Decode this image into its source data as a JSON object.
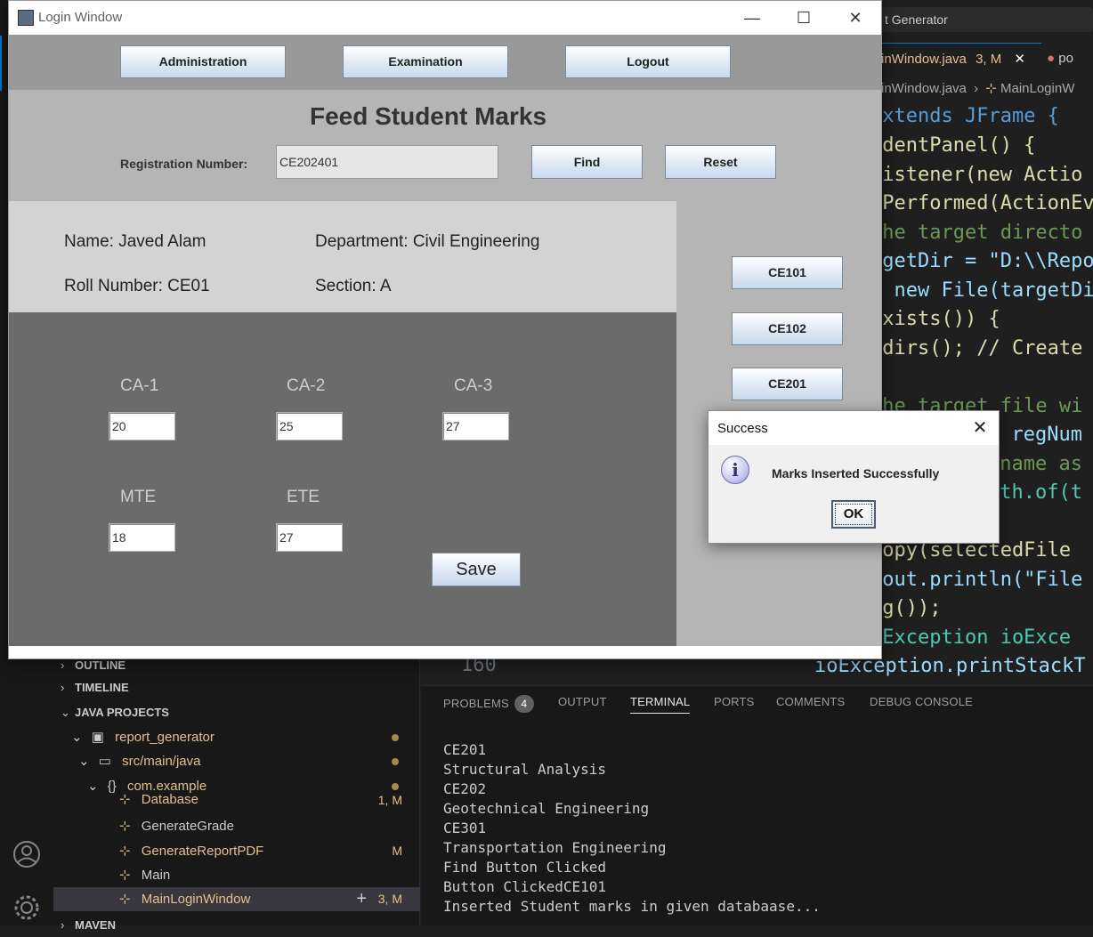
{
  "vscode": {
    "window_title_fragment": "t Generator",
    "active_tab": "inWindow.java",
    "active_tab_badge": "3, M",
    "second_tab": "po",
    "breadcrumb": [
      "inWindow.java",
      "MainLoginW"
    ],
    "code_lines": [
      "xtends JFrame {",
      "udentPanel() {",
      "Listener(new Actio",
      "nPerformed(ActionEv",
      "the target directo",
      "rgetDir = \"D:\\\\Repo",
      "= new File(targetDi",
      "exists()) {",
      "kdirs(); // Create",
      "",
      "the target file wi",
      "= regNum",
      " name as",
      "ath.of(t",
      "",
      "copy(selectedFile",
      ".out.println(\"File",
      "ng());",
      "OException ioExce",
      "ioException.printStackT"
    ],
    "line_number": "160",
    "sidebar_sections": {
      "outline": "OUTLINE",
      "timeline": "TIMELINE",
      "java_projects": "JAVA PROJECTS",
      "maven": "MAVEN"
    },
    "tree": [
      {
        "label": "report_generator",
        "badge": ""
      },
      {
        "label": "src/main/java",
        "badge": ""
      },
      {
        "label": "com.example",
        "badge": ""
      },
      {
        "label": "Database",
        "badge": "1, M"
      },
      {
        "label": "GenerateGrade",
        "badge": ""
      },
      {
        "label": "GenerateReportPDF",
        "badge": "M"
      },
      {
        "label": "Main",
        "badge": ""
      },
      {
        "label": "MainLoginWindow",
        "badge": "3, M"
      }
    ],
    "tree_add": "+",
    "panel_tabs": {
      "problems": "PROBLEMS",
      "problems_count": "4",
      "output": "OUTPUT",
      "terminal": "TERMINAL",
      "ports": "PORTS",
      "comments": "COMMENTS",
      "debug_console": "DEBUG CONSOLE"
    },
    "terminal_lines": [
      "CE201",
      "Structural Analysis",
      "CE202",
      "Geotechnical Engineering",
      "CE301",
      "Transportation Engineering",
      "Find Button Clicked",
      "Button ClickedCE101",
      "Inserted Student marks in given databaase..."
    ]
  },
  "login_window": {
    "title": "Login Window",
    "controls": {
      "minimize": "—",
      "maximize": "☐",
      "close": "✕"
    },
    "nav": {
      "administration": "Administration",
      "examination": "Examination",
      "logout": "Logout"
    },
    "heading": "Feed Student Marks",
    "registration": {
      "label": "Registration Number:",
      "value": "CE202401",
      "find": "Find",
      "reset": "Reset"
    },
    "student": {
      "name": "Name: Javed Alam",
      "department": "Department: Civil Engineering",
      "roll": "Roll Number: CE01",
      "section": "Section: A"
    },
    "marks": {
      "ca1_label": "CA-1",
      "ca1_value": "20",
      "ca2_label": "CA-2",
      "ca2_value": "25",
      "ca3_label": "CA-3",
      "ca3_value": "27",
      "mte_label": "MTE",
      "mte_value": "18",
      "ete_label": "ETE",
      "ete_value": "27",
      "save": "Save"
    },
    "courses": [
      "CE101",
      "CE102",
      "CE201"
    ]
  },
  "dialog": {
    "title": "Success",
    "close": "✕",
    "icon": "info-icon",
    "message": "Marks Inserted Successfully",
    "ok": "OK"
  }
}
